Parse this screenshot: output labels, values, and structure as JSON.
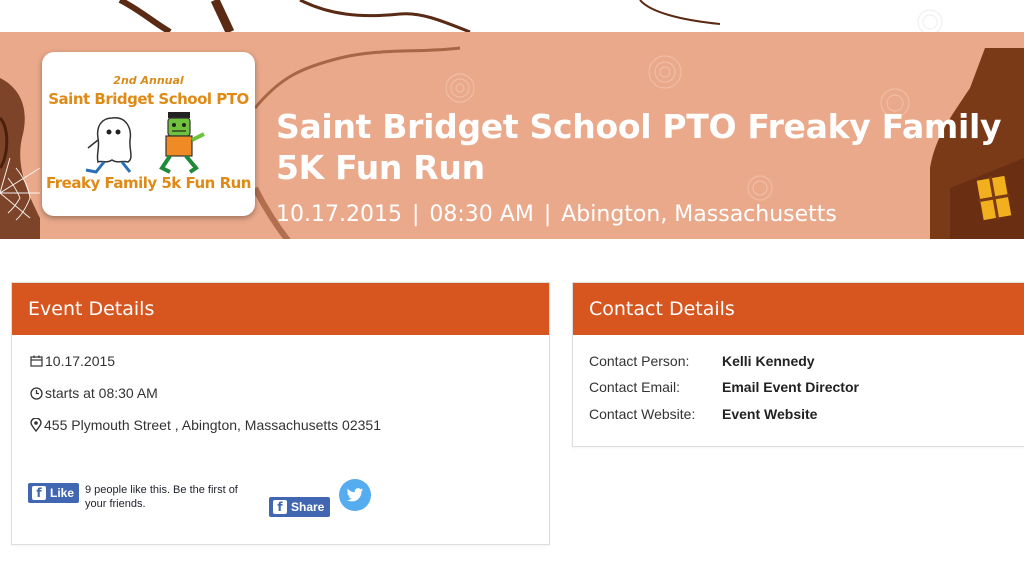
{
  "banner": {
    "title": "Saint Bridget School PTO Freaky Family 5K Fun Run",
    "date": "10.17.2015",
    "time": "08:30 AM",
    "location": "Abington, Massachusetts",
    "separator": "|",
    "background_color": "#eaa98a"
  },
  "logo": {
    "annual": "2nd Annual",
    "title": "Saint Bridget School PTO",
    "subtitle": "Freaky Family 5k Fun Run"
  },
  "event_details": {
    "header": "Event Details",
    "date": "10.17.2015",
    "time": "starts at 08:30 AM",
    "address": "455 Plymouth Street , Abington, Massachusetts 02351",
    "icons": [
      "calendar-icon",
      "clock-icon",
      "map-pin-icon"
    ],
    "header_color": "#d7551f"
  },
  "social": {
    "like_label": "Like",
    "like_text": "9 people like this. Be the first of your friends.",
    "share_label": "Share",
    "facebook_color": "#4267b2",
    "twitter_color": "#55acee"
  },
  "contact_details": {
    "header": "Contact Details",
    "rows": [
      {
        "label": "Contact Person:",
        "value": "Kelli Kennedy"
      },
      {
        "label": "Contact Email:",
        "value": "Email Event Director"
      },
      {
        "label": "Contact Website:",
        "value": "Event Website"
      }
    ]
  }
}
